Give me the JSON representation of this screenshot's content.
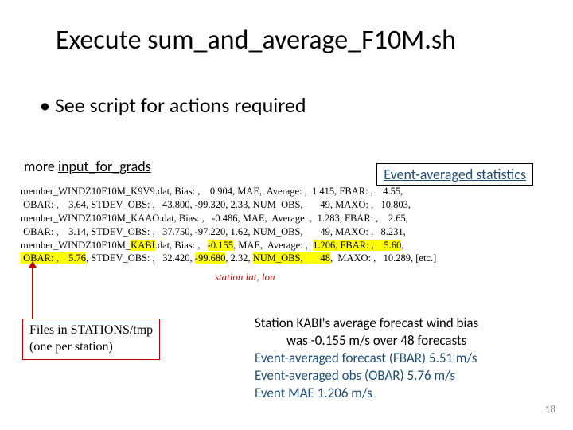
{
  "title_prefix": "Execute ",
  "title_script": "sum_and_average_F10M.sh",
  "bullet1": "See script for actions required",
  "label_left_pre": "more ",
  "label_left_file": "input_for_grads",
  "label_right": "Event-averaged statistics",
  "stats_line1a": "member_WINDZ10F10M_K9V9.dat, Bias: ,    0.904, MAE,  Average: ,  1.415, FBAR: ,    4.55,",
  "stats_line1b": " OBAR: ,    3.64, STDEV_OBS: ,   43.800, -99.320, 2.33, NUM_OBS,       49, MAXO: ,   10.803,",
  "stats_line2a": "member_WINDZ10F10M_KAAO.dat, Bias: ,   -0.486, MAE,  Average: ,  1.283, FBAR: ,    2.65,",
  "stats_line2b": " OBAR: ,    3.14, STDEV_OBS: ,   37.750, -97.220, 1.62, NUM_OBS,       49, MAXO: ,   8.231,",
  "stats_line3a_pre": "member_WINDZ10F10M_",
  "stats_line3a_kabi": "KABI",
  "stats_line3a_mid": ".dat, Bias: ,   ",
  "stats_line3a_bias": "-0.155",
  "stats_line3a_post": ", MAE,  Average: ,  ",
  "stats_line3a_avg": "1.206,",
  "stats_line3a_fbar": " FBAR: ,    ",
  "stats_line3a_fbarv": "5.60",
  "stats_line3a_end": ",",
  "stats_line3b_pre": " OBAR: ,    ",
  "stats_line3b_obar": "5.76",
  "stats_line3b_mid": ", STDEV_OBS: ,   32.420, ",
  "stats_line3b_lon": "-99.680",
  "stats_line3b_post": ", 2.32, ",
  "stats_line3b_num": "NUM_OBS,       48",
  "stats_line3b_end": ",  MAXO: ,   10.289, [etc.]",
  "station_lat": "station lat, lon",
  "files_box_l1": "Files in STATIONS/tmp",
  "files_box_l2": "(one per station)",
  "summary_l1": "Station KABI's average forecast wind bias",
  "summary_l2": "was -0.155 m/s over 48 forecasts",
  "summary_l3": "Event-averaged forecast (FBAR) 5.51 m/s",
  "summary_l4": "Event-averaged obs (OBAR) 5.76 m/s",
  "summary_l5": "Event MAE 1.206 m/s",
  "slide_number": "18"
}
